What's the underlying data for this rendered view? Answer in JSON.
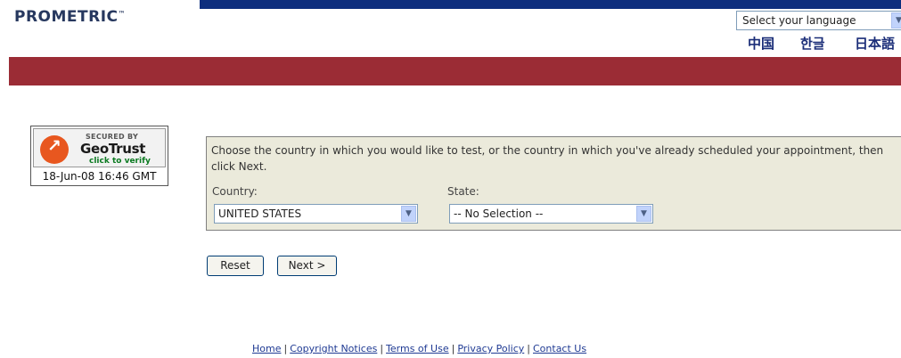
{
  "header": {
    "logo_text": "PROMETRIC",
    "logo_tm": "™",
    "language_select": {
      "placeholder": "Select your language",
      "arrow": "▼"
    },
    "language_links": [
      "中国",
      "한글",
      "日本語"
    ],
    "colors": {
      "top_bar": "#0d2e7e",
      "band": "#9b2c35",
      "logo": "#27385f"
    }
  },
  "badge": {
    "secured_by": "SECURED BY",
    "brand": "GeoTrust",
    "verify": "click to verify",
    "date": "18-Jun-08 16:46 GMT",
    "icon": "geotrust-logo-icon"
  },
  "form": {
    "instructions": "Choose the country in which you would like to test, or the country in which you've already scheduled your appointment, then click Next.",
    "country": {
      "label": "Country:",
      "value": "UNITED STATES"
    },
    "state": {
      "label": "State:",
      "value": "-- No Selection --"
    },
    "reset_label": "Reset",
    "next_label": "Next >"
  },
  "footer": {
    "links": [
      "Home",
      "Copyright Notices",
      "Terms of Use",
      "Privacy Policy",
      "Contact Us"
    ],
    "separator": "|"
  }
}
